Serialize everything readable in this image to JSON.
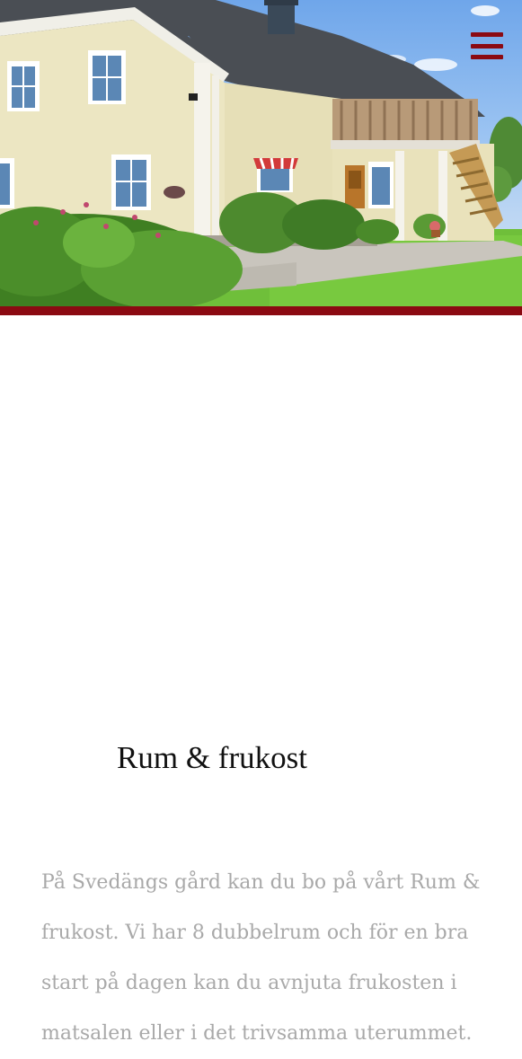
{
  "page": {
    "title": "Rum & frukost",
    "description": "På Svedängs gård kan du bo på vårt Rum & frukost. Vi har 8 dubbelrum och för en bra start på dagen kan du avnjuta frukosten i matsalen eller i det trivsamma uterummet."
  },
  "icons": {
    "menu": "hamburger-menu-icon"
  },
  "colors": {
    "accent": "#8b0a12",
    "title": "#111111",
    "body_text": "#a9a9a9",
    "background": "#ffffff"
  }
}
